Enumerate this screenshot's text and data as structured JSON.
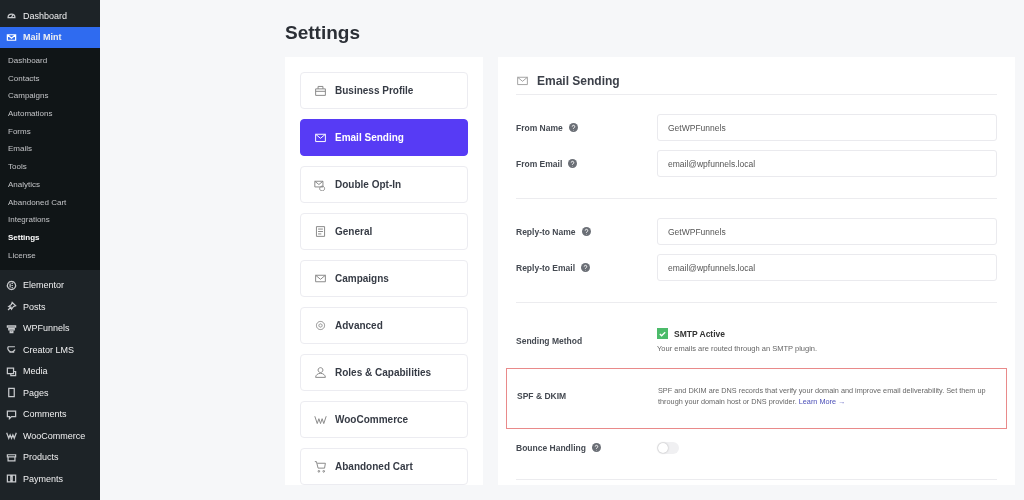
{
  "sidebar": {
    "menu": [
      {
        "label": "Dashboard",
        "selected": false
      },
      {
        "label": "Mail Mint",
        "selected": true,
        "expanded": true,
        "children": [
          {
            "label": "Dashboard",
            "selected": false
          },
          {
            "label": "Contacts",
            "selected": false
          },
          {
            "label": "Campaigns",
            "selected": false
          },
          {
            "label": "Automations",
            "selected": false
          },
          {
            "label": "Forms",
            "selected": false
          },
          {
            "label": "Emails",
            "selected": false
          },
          {
            "label": "Tools",
            "selected": false
          },
          {
            "label": "Analytics",
            "selected": false
          },
          {
            "label": "Abandoned Cart",
            "selected": false
          },
          {
            "label": "Integrations",
            "selected": false
          },
          {
            "label": "Settings",
            "selected": true
          },
          {
            "label": "License",
            "selected": false
          }
        ]
      },
      {
        "label": "Elementor",
        "selected": false
      },
      {
        "label": "Posts",
        "selected": false
      },
      {
        "label": "WPFunnels",
        "selected": false
      },
      {
        "label": "Creator LMS",
        "selected": false
      },
      {
        "label": "Media",
        "selected": false
      },
      {
        "label": "Pages",
        "selected": false
      },
      {
        "label": "Comments",
        "selected": false
      },
      {
        "label": "WooCommerce",
        "selected": false
      },
      {
        "label": "Products",
        "selected": false
      },
      {
        "label": "Payments",
        "selected": false
      }
    ]
  },
  "page_title": "Settings",
  "settings_nav": [
    {
      "label": "Business Profile",
      "selected": false
    },
    {
      "label": "Email Sending",
      "selected": true
    },
    {
      "label": "Double Opt-In",
      "selected": false
    },
    {
      "label": "General",
      "selected": false
    },
    {
      "label": "Campaigns",
      "selected": false
    },
    {
      "label": "Advanced",
      "selected": false
    },
    {
      "label": "Roles & Capabilities",
      "selected": false
    },
    {
      "label": "WooCommerce",
      "selected": false
    },
    {
      "label": "Abandoned Cart",
      "selected": false
    }
  ],
  "panel": {
    "title": "Email Sending",
    "sections": [
      {
        "rows": [
          {
            "kind": "text",
            "label": "From Name",
            "help": true,
            "value": "GetWPFunnels"
          },
          {
            "kind": "text",
            "label": "From Email",
            "help": true,
            "value": "email@wpfunnels.local"
          }
        ]
      },
      {
        "rows": [
          {
            "kind": "text",
            "label": "Reply-to Name",
            "help": true,
            "value": "GetWPFunnels"
          },
          {
            "kind": "text",
            "label": "Reply-to Email",
            "help": true,
            "value": "email@wpfunnels.local"
          }
        ]
      },
      {
        "rows": [
          {
            "kind": "checkbox",
            "label": "Sending Method",
            "help": false,
            "option": "SMTP Active",
            "checked": true,
            "note": "Your emails are routed through an SMTP plugin."
          },
          {
            "kind": "info",
            "label": "SPF & DKIM",
            "help": false,
            "highlighted": true,
            "text": "SPF and DKIM are DNS records that verify your domain and improve email deliverability. Set them up through your domain host or DNS provider.",
            "link": "Learn More →"
          },
          {
            "kind": "toggle",
            "label": "Bounce Handling",
            "help": true,
            "on": false
          }
        ]
      }
    ]
  }
}
